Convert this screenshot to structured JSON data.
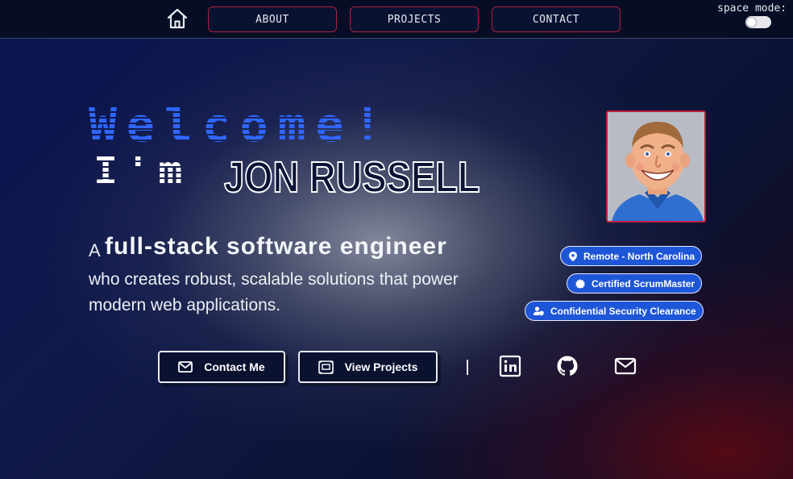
{
  "nav": {
    "items": [
      {
        "label": "ABOUT"
      },
      {
        "label": "PROJECTS"
      },
      {
        "label": "CONTACT"
      }
    ],
    "space_mode_label": "space mode:"
  },
  "hero": {
    "welcome": "Welcome!",
    "im": "I'm",
    "name": "JON RUSSELL",
    "tagline_prefix": "A",
    "tagline_strong": "full-stack software engineer",
    "tagline_rest": "who creates robust, scalable solutions that power modern web applications."
  },
  "badges": [
    {
      "label": "Remote - North Carolina",
      "icon": "location-pin-icon"
    },
    {
      "label": "Certified ScrumMaster",
      "icon": "certified-badge-icon"
    },
    {
      "label": "Confidential Security Clearance",
      "icon": "user-shield-icon"
    }
  ],
  "cta": {
    "contact_label": "Contact Me",
    "projects_label": "View Projects"
  },
  "social": [
    "linkedin-icon",
    "github-icon",
    "mail-icon"
  ],
  "colors": {
    "accent_blue": "#2f66ff",
    "nav_border": "#b0203a",
    "badge_bg": "#1e56d8"
  }
}
